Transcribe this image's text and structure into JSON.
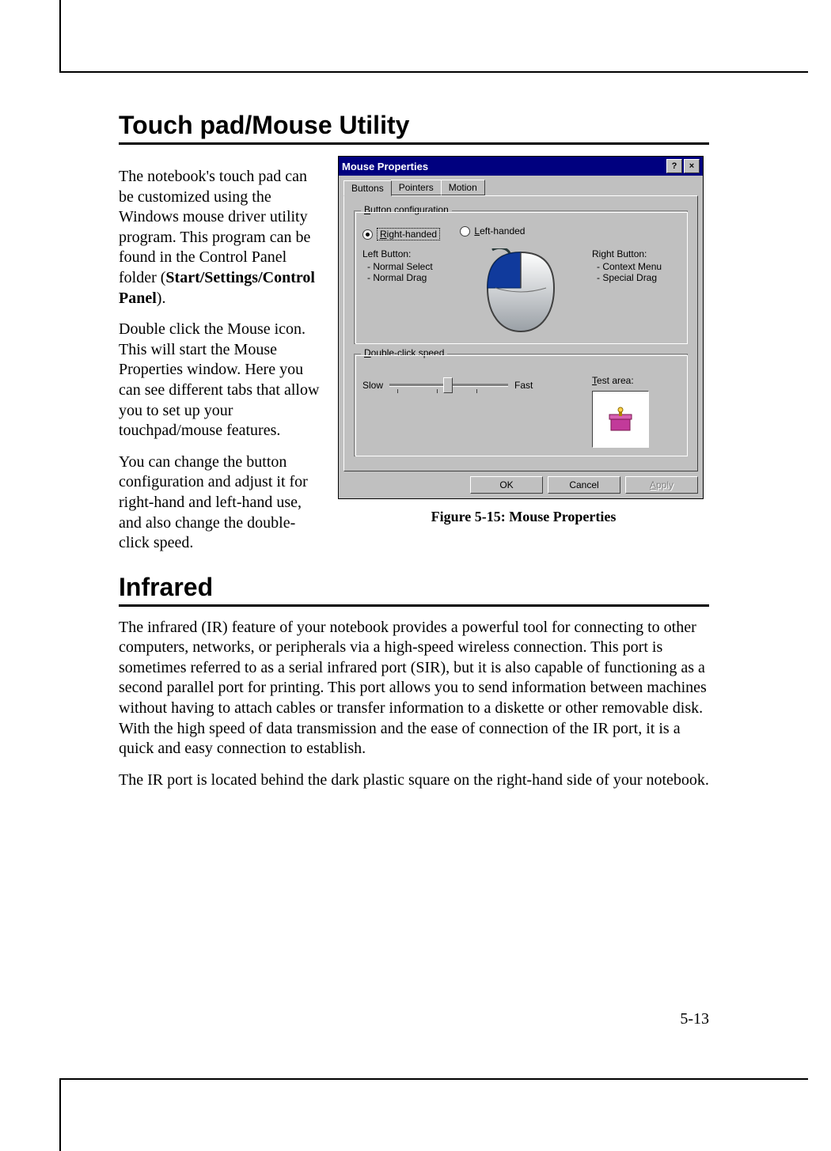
{
  "section1": {
    "heading": "Touch pad/Mouse Utility",
    "p1_a": "The notebook's touch pad can be customized using the Windows mouse driver utility program. This program can be found in the Control Panel folder (",
    "p1_b": "Start/Settings/Control Panel",
    "p1_c": ").",
    "p2": "Double click the Mouse icon. This will start the Mouse Properties window. Here you can see different tabs that allow you to set up your touchpad/mouse features.",
    "p3": "You can change the button configuration and adjust it for right-hand and left-hand use, and also change the double-click speed."
  },
  "figure_caption": "Figure 5-15: Mouse Properties",
  "dialog": {
    "title": "Mouse Properties",
    "help_glyph": "?",
    "close_glyph": "×",
    "tabs": {
      "buttons": "Buttons",
      "pointers": "Pointers",
      "motion": "Motion"
    },
    "group_button_config": {
      "label_prefix": "B",
      "label_rest": "utton configuration",
      "radio_right_prefix": "R",
      "radio_right_rest": "ight-handed",
      "radio_left_prefix": "L",
      "radio_left_rest": "eft-handed",
      "left_hdr": "Left Button:",
      "left_i1": "- Normal Select",
      "left_i2": "- Normal Drag",
      "right_hdr": "Right Button:",
      "right_i1": "- Context Menu",
      "right_i2": "- Special Drag"
    },
    "group_speed": {
      "label_prefix": "D",
      "label_rest": "ouble-click speed",
      "slow": "Slow",
      "fast": "Fast",
      "test_prefix": "T",
      "test_rest": "est area:",
      "jack_glyph": "🃏"
    },
    "buttons": {
      "ok": "OK",
      "cancel": "Cancel",
      "apply_prefix": "A",
      "apply_rest": "pply"
    }
  },
  "section2": {
    "heading": "Infrared",
    "p1": "The infrared (IR) feature of your notebook provides a powerful tool for connecting to other computers, networks, or peripherals via a high-speed wireless connection. This port is sometimes referred to as a serial infrared port (SIR), but it is also capable of functioning as a second parallel port for printing. This port allows you to send information between machines without having to attach cables or transfer information to a diskette or other removable disk. With the high speed of data transmission and the ease of connection of the IR port, it is a quick and easy connection to establish.",
    "p2": "The IR port is located behind the dark plastic square on the right-hand side of your notebook."
  },
  "page_number": "5-13"
}
